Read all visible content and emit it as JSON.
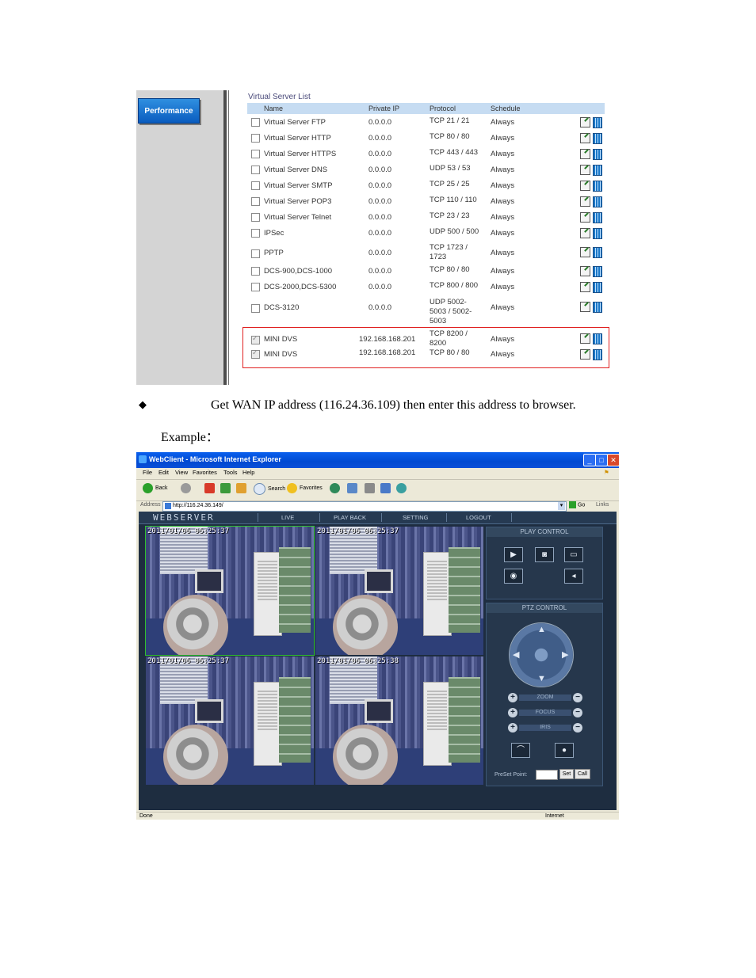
{
  "top_screenshot": {
    "sidebar_button": "Performance",
    "list_title": "Virtual Server List",
    "columns": [
      "Name",
      "Private IP",
      "Protocol",
      "Schedule"
    ],
    "rows": [
      {
        "name": "Virtual Server FTP",
        "ip": "0.0.0.0",
        "protocol": "TCP 21 / 21",
        "schedule": "Always",
        "checked": false
      },
      {
        "name": "Virtual Server HTTP",
        "ip": "0.0.0.0",
        "protocol": "TCP 80 / 80",
        "schedule": "Always",
        "checked": false
      },
      {
        "name": "Virtual Server HTTPS",
        "ip": "0.0.0.0",
        "protocol": "TCP 443 / 443",
        "schedule": "Always",
        "checked": false
      },
      {
        "name": "Virtual Server DNS",
        "ip": "0.0.0.0",
        "protocol": "UDP 53 / 53",
        "schedule": "Always",
        "checked": false
      },
      {
        "name": "Virtual Server SMTP",
        "ip": "0.0.0.0",
        "protocol": "TCP 25 / 25",
        "schedule": "Always",
        "checked": false
      },
      {
        "name": "Virtual Server POP3",
        "ip": "0.0.0.0",
        "protocol": "TCP 110 / 110",
        "schedule": "Always",
        "checked": false
      },
      {
        "name": "Virtual Server Telnet",
        "ip": "0.0.0.0",
        "protocol": "TCP 23 / 23",
        "schedule": "Always",
        "checked": false
      },
      {
        "name": "IPSec",
        "ip": "0.0.0.0",
        "protocol": "UDP 500 / 500",
        "schedule": "Always",
        "checked": false
      },
      {
        "name": "PPTP",
        "ip": "0.0.0.0",
        "protocol": "TCP 1723 / 1723",
        "schedule": "Always",
        "checked": false
      },
      {
        "name": "DCS-900,DCS-1000",
        "ip": "0.0.0.0",
        "protocol": "TCP 80 / 80",
        "schedule": "Always",
        "checked": false
      },
      {
        "name": "DCS-2000,DCS-5300",
        "ip": "0.0.0.0",
        "protocol": "TCP 800 / 800",
        "schedule": "Always",
        "checked": false
      },
      {
        "name": "DCS-3120",
        "ip": "0.0.0.0",
        "protocol": "UDP 5002-5003 / 5002-5003",
        "schedule": "Always",
        "checked": false
      },
      {
        "name": "MINI DVS",
        "ip": "192.168.168.201",
        "protocol": "TCP 8200 / 8200",
        "schedule": "Always",
        "checked": true
      },
      {
        "name": "MINI DVS",
        "ip": "192.168.168.201",
        "protocol": "TCP 80 / 80",
        "schedule": "Always",
        "checked": true
      }
    ]
  },
  "text": {
    "bullet": "◆",
    "instruction": "Get WAN IP address (116.24.36.109) then enter this address to browser.",
    "example": "Example："
  },
  "browser": {
    "window_title": "WebClient - Microsoft Internet Explorer",
    "menu": [
      "File",
      "Edit",
      "View",
      "Favorites",
      "Tools",
      "Help"
    ],
    "toolbar": {
      "back": "Back",
      "search": "Search",
      "favorites": "Favorites"
    },
    "address_label": "Address",
    "address_url": "http://116.24.36.149/",
    "go": "Go",
    "links": "Links",
    "status_left": "Done",
    "status_right": "Internet",
    "webapp": {
      "brand": "WEBSERVER",
      "nav": [
        "LIVE",
        "PLAY BACK",
        "SETTING",
        "LOGOUT"
      ],
      "timestamps": [
        "2011/01/06 06:25:37",
        "2011/01/06 06:25:37",
        "2011/01/06 06:25:37",
        "2011/01/06 06:25:38"
      ],
      "play_control_title": "PLAY CONTROL",
      "ptz_control_title": "PTZ CONTROL",
      "ptz_rows": [
        "ZOOM",
        "FOCUS",
        "IRIS"
      ],
      "preset_label": "PreSet Point:",
      "set": "Set",
      "call": "Call"
    }
  }
}
